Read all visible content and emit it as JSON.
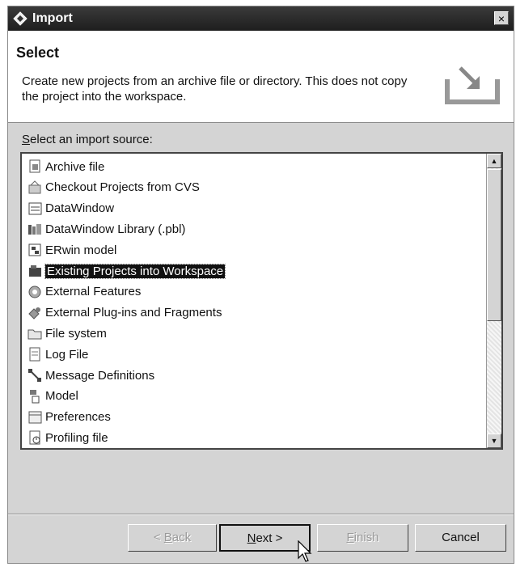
{
  "window": {
    "title": "Import",
    "close_label": "×"
  },
  "header": {
    "title": "Select",
    "description": "Create new projects from an archive file or directory. This does not copy the project into the workspace."
  },
  "source": {
    "label_u": "S",
    "label_rest": "elect an import source:"
  },
  "items": [
    {
      "label": "Archive file",
      "icon": "archive-file-icon"
    },
    {
      "label": "Checkout Projects from CVS",
      "icon": "cvs-icon"
    },
    {
      "label": "DataWindow",
      "icon": "datawindow-icon"
    },
    {
      "label": "DataWindow Library (.pbl)",
      "icon": "library-icon"
    },
    {
      "label": "ERwin model",
      "icon": "erwin-icon"
    },
    {
      "label": "Existing Projects into Workspace",
      "icon": "project-icon",
      "selected": true
    },
    {
      "label": "External Features",
      "icon": "features-icon"
    },
    {
      "label": "External Plug-ins and Fragments",
      "icon": "plugins-icon"
    },
    {
      "label": "File system",
      "icon": "folder-icon"
    },
    {
      "label": "Log File",
      "icon": "log-file-icon"
    },
    {
      "label": "Message Definitions",
      "icon": "message-definitions-icon"
    },
    {
      "label": "Model",
      "icon": "model-icon"
    },
    {
      "label": "Preferences",
      "icon": "preferences-icon"
    },
    {
      "label": "Profiling file",
      "icon": "profiling-file-icon"
    }
  ],
  "buttons": {
    "back": {
      "u": "B",
      "pre": "< ",
      "post": "ack"
    },
    "next": {
      "u": "N",
      "pre": "",
      "post": "ext >"
    },
    "finish": {
      "u": "F",
      "pre": "",
      "post": "inish"
    },
    "cancel": "Cancel"
  }
}
